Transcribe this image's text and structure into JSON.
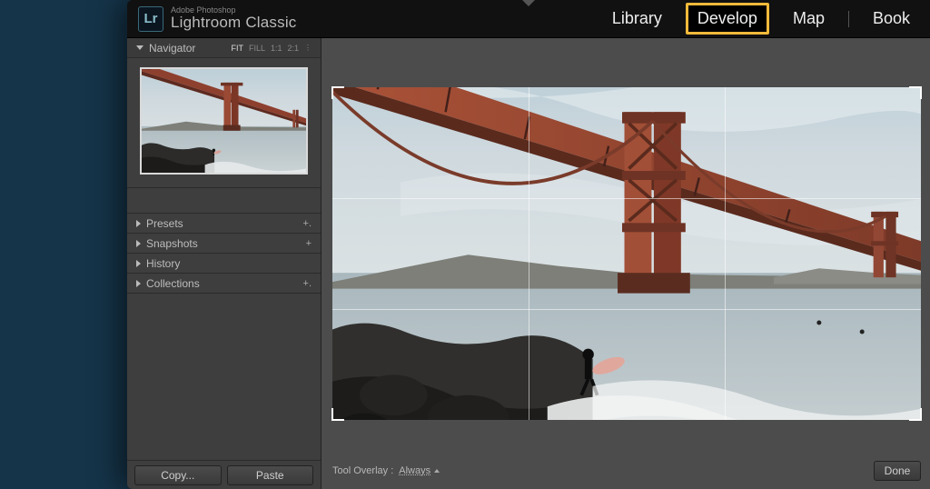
{
  "app": {
    "logo_text": "Lr",
    "brand_small": "Adobe Photoshop",
    "brand_big": "Lightroom Classic"
  },
  "modules": {
    "library": "Library",
    "develop": "Develop",
    "map": "Map",
    "book": "Book"
  },
  "active_module": "develop",
  "navigator": {
    "title": "Navigator",
    "zoom": {
      "fit": "FIT",
      "fill": "FILL",
      "one_one": "1:1",
      "two_one": "2:1"
    }
  },
  "panels": {
    "presets": "Presets",
    "snapshots": "Snapshots",
    "history": "History",
    "collections": "Collections"
  },
  "buttons": {
    "copy": "Copy...",
    "paste": "Paste",
    "done": "Done"
  },
  "tool_overlay": {
    "label": "Tool Overlay :",
    "value": "Always"
  }
}
